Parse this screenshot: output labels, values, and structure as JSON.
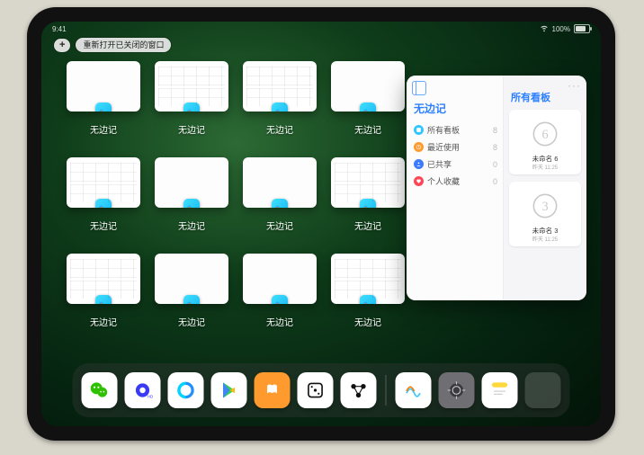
{
  "status": {
    "time": "9:41",
    "battery_pct": "100%"
  },
  "topbar": {
    "plus_label": "+",
    "reopen_label": "重新打开已关闭的窗口"
  },
  "windows": [
    {
      "label": "无边记",
      "style": "blank"
    },
    {
      "label": "无边记",
      "style": "grid"
    },
    {
      "label": "无边记",
      "style": "grid"
    },
    {
      "label": "无边记",
      "style": "blank"
    },
    {
      "label": "无边记",
      "style": "grid"
    },
    {
      "label": "无边记",
      "style": "blank"
    },
    {
      "label": "无边记",
      "style": "blank"
    },
    {
      "label": "无边记",
      "style": "grid"
    },
    {
      "label": "无边记",
      "style": "grid"
    },
    {
      "label": "无边记",
      "style": "blank"
    },
    {
      "label": "无边记",
      "style": "blank"
    },
    {
      "label": "无边记",
      "style": "grid"
    }
  ],
  "panel": {
    "title_left": "无边记",
    "title_right": "所有看板",
    "ellipsis": "···",
    "items": [
      {
        "label": "所有看板",
        "count": "8",
        "color": "#31c6ff"
      },
      {
        "label": "最近使用",
        "count": "8",
        "color": "#ff9a2e"
      },
      {
        "label": "已共享",
        "count": "0",
        "color": "#3b7bff"
      },
      {
        "label": "个人收藏",
        "count": "0",
        "color": "#ff4757"
      }
    ],
    "boards": [
      {
        "name": "未命名 6",
        "sub": "昨天 11:25",
        "digit": "6"
      },
      {
        "name": "未命名 3",
        "sub": "昨天 11:25",
        "digit": "3"
      }
    ]
  },
  "dock": {
    "apps": [
      {
        "name": "wechat",
        "bg": "#ffffff"
      },
      {
        "name": "quark",
        "bg": "#ffffff"
      },
      {
        "name": "qqbrowser",
        "bg": "#ffffff"
      },
      {
        "name": "play",
        "bg": "#ffffff"
      },
      {
        "name": "books",
        "bg": "#ff9a2e"
      },
      {
        "name": "dice",
        "bg": "#ffffff"
      },
      {
        "name": "nodes",
        "bg": "#ffffff"
      },
      {
        "name": "freeform",
        "bg": "#ffffff"
      },
      {
        "name": "settings",
        "bg": "#6e6e73"
      },
      {
        "name": "notes",
        "bg": "#ffffff"
      }
    ]
  }
}
